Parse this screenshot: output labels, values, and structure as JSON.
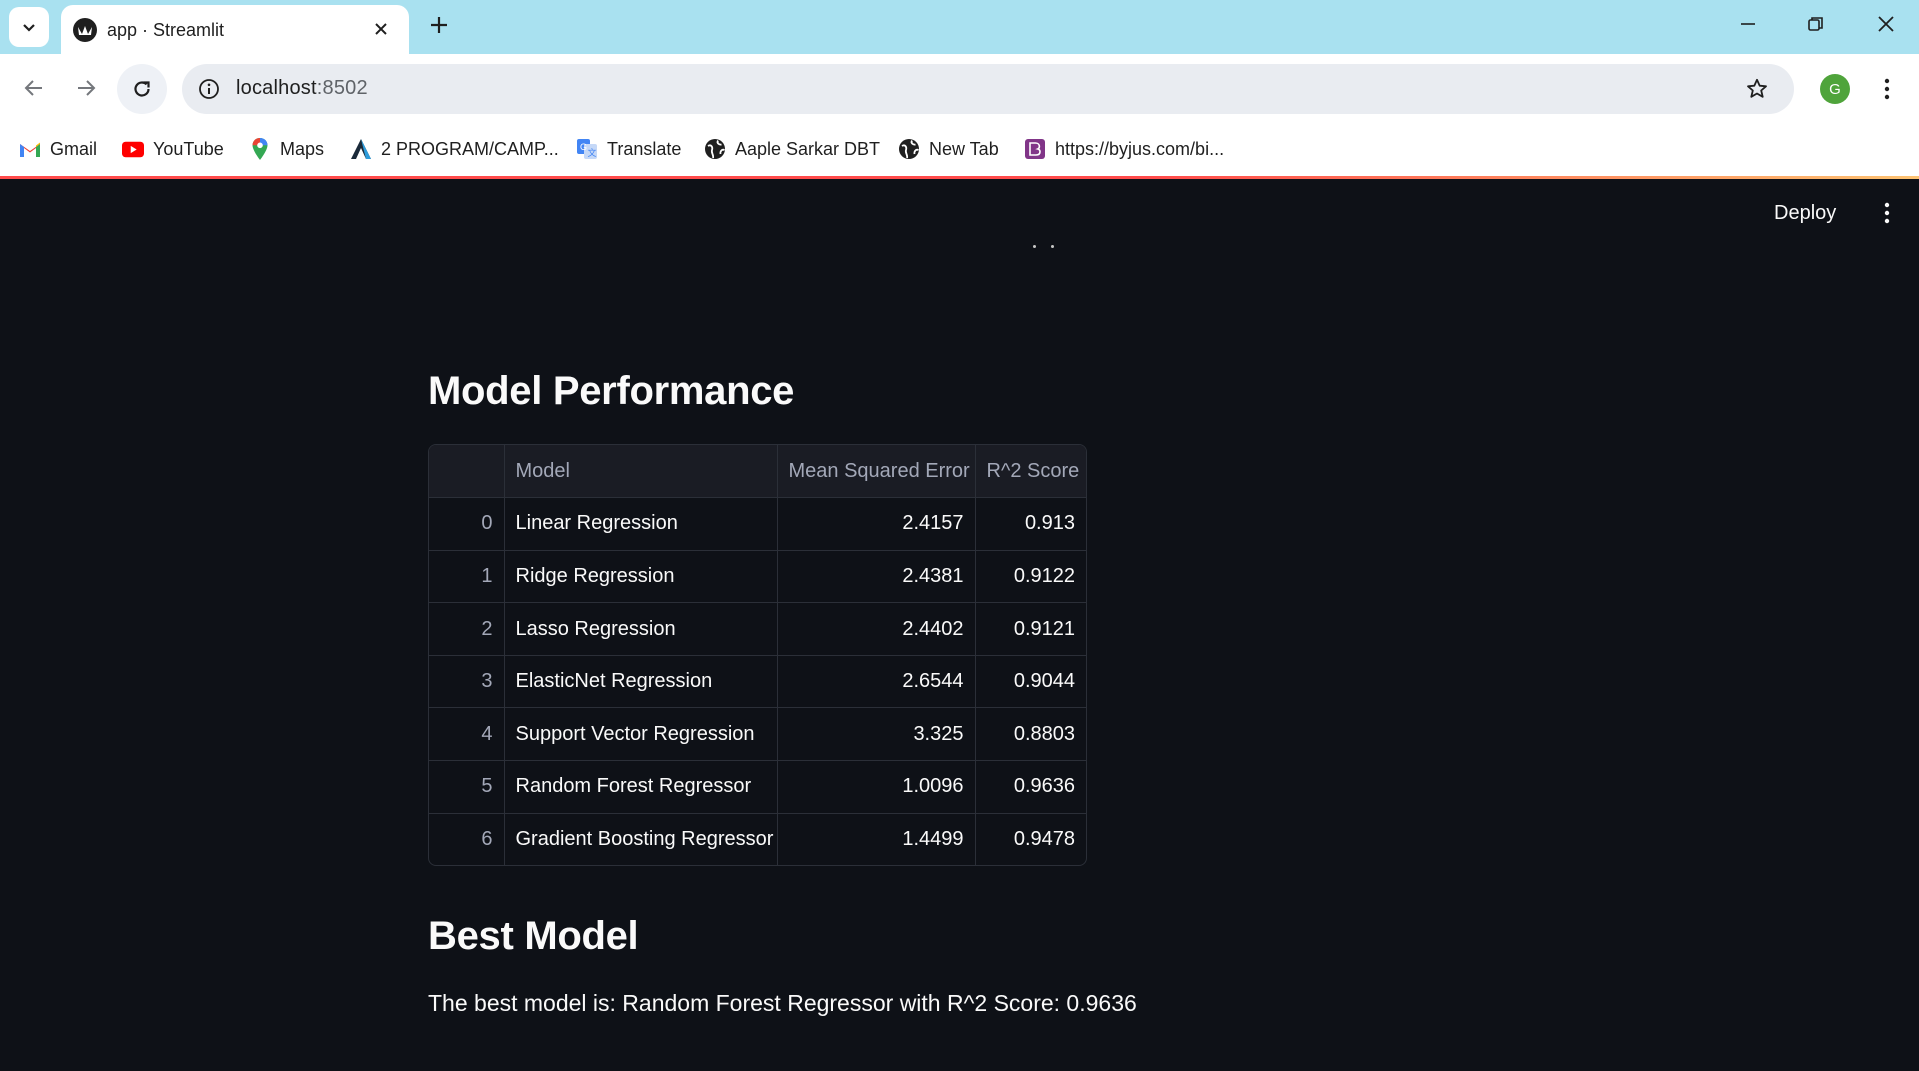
{
  "browser": {
    "tab_title": "app · Streamlit",
    "url_host": "localhost",
    "url_port": ":8502",
    "profile_initial": "G",
    "bookmarks": [
      {
        "label": "Gmail",
        "icon": "gmail-icon"
      },
      {
        "label": "YouTube",
        "icon": "youtube-icon"
      },
      {
        "label": "Maps",
        "icon": "maps-icon"
      },
      {
        "label": "2 PROGRAM/CAMP...",
        "icon": "program-icon"
      },
      {
        "label": "Translate",
        "icon": "translate-icon"
      },
      {
        "label": "Aaple Sarkar DBT",
        "icon": "globe-icon"
      },
      {
        "label": "New Tab",
        "icon": "globe-icon"
      },
      {
        "label": "https://byjus.com/bi...",
        "icon": "byjus-icon"
      }
    ]
  },
  "app": {
    "deploy_label": "Deploy",
    "performance_title": "Model Performance",
    "table": {
      "columns": [
        "",
        "Model",
        "Mean Squared Error",
        "R^2 Score"
      ],
      "rows": [
        {
          "index": "0",
          "model": "Linear Regression",
          "mse": "2.4157",
          "r2": "0.913"
        },
        {
          "index": "1",
          "model": "Ridge Regression",
          "mse": "2.4381",
          "r2": "0.9122"
        },
        {
          "index": "2",
          "model": "Lasso Regression",
          "mse": "2.4402",
          "r2": "0.9121"
        },
        {
          "index": "3",
          "model": "ElasticNet Regression",
          "mse": "2.6544",
          "r2": "0.9044"
        },
        {
          "index": "4",
          "model": "Support Vector Regression",
          "mse": "3.325",
          "r2": "0.8803"
        },
        {
          "index": "5",
          "model": "Random Forest Regressor",
          "mse": "1.0096",
          "r2": "0.9636"
        },
        {
          "index": "6",
          "model": "Gradient Boosting Regressor",
          "mse": "1.4499",
          "r2": "0.9478"
        }
      ]
    },
    "best_title": "Best Model",
    "best_text": "The best model is: Random Forest Regressor with R^2 Score: 0.9636"
  },
  "colors": {
    "app_background": "#0e1117",
    "tabbar": "#a9e1f0",
    "accent": "#ff4b4b"
  }
}
